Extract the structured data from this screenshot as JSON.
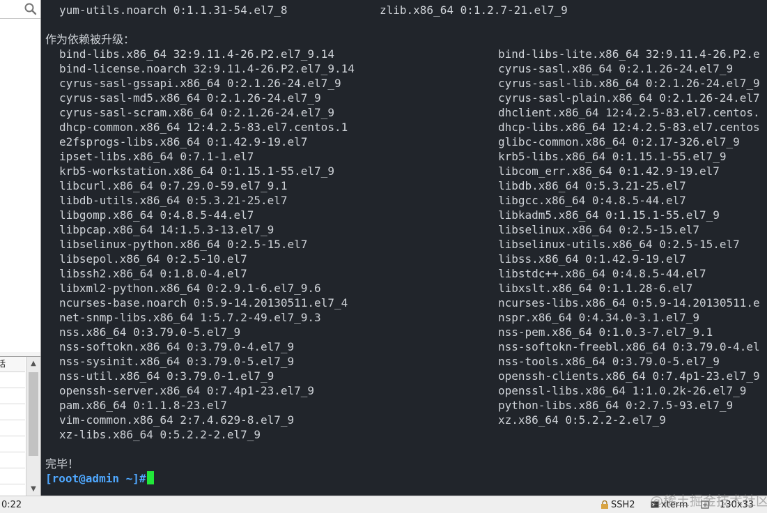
{
  "terminal": {
    "line_top_a": "yum-utils.noarch 0:1.1.31-54.el7_8",
    "line_top_b": "zlib.x86_64 0:1.2.7-21.el7_9",
    "section_header": "作为依赖被升级：",
    "left_col": [
      "bind-libs.x86_64 32:9.11.4-26.P2.el7_9.14",
      "bind-license.noarch 32:9.11.4-26.P2.el7_9.14",
      "cyrus-sasl-gssapi.x86_64 0:2.1.26-24.el7_9",
      "cyrus-sasl-md5.x86_64 0:2.1.26-24.el7_9",
      "cyrus-sasl-scram.x86_64 0:2.1.26-24.el7_9",
      "dhcp-common.x86_64 12:4.2.5-83.el7.centos.1",
      "e2fsprogs-libs.x86_64 0:1.42.9-19.el7",
      "ipset-libs.x86_64 0:7.1-1.el7",
      "krb5-workstation.x86_64 0:1.15.1-55.el7_9",
      "libcurl.x86_64 0:7.29.0-59.el7_9.1",
      "libdb-utils.x86_64 0:5.3.21-25.el7",
      "libgomp.x86_64 0:4.8.5-44.el7",
      "libpcap.x86_64 14:1.5.3-13.el7_9",
      "libselinux-python.x86_64 0:2.5-15.el7",
      "libsepol.x86_64 0:2.5-10.el7",
      "libssh2.x86_64 0:1.8.0-4.el7",
      "libxml2-python.x86_64 0:2.9.1-6.el7_9.6",
      "ncurses-base.noarch 0:5.9-14.20130511.el7_4",
      "net-snmp-libs.x86_64 1:5.7.2-49.el7_9.3",
      "nss.x86_64 0:3.79.0-5.el7_9",
      "nss-softokn.x86_64 0:3.79.0-4.el7_9",
      "nss-sysinit.x86_64 0:3.79.0-5.el7_9",
      "nss-util.x86_64 0:3.79.0-1.el7_9",
      "openssh-server.x86_64 0:7.4p1-23.el7_9",
      "pam.x86_64 0:1.1.8-23.el7",
      "vim-common.x86_64 2:7.4.629-8.el7_9",
      "xz-libs.x86_64 0:5.2.2-2.el7_9"
    ],
    "right_col": [
      "bind-libs-lite.x86_64 32:9.11.4-26.P2.e",
      "cyrus-sasl.x86_64 0:2.1.26-24.el7_9",
      "cyrus-sasl-lib.x86_64 0:2.1.26-24.el7_9",
      "cyrus-sasl-plain.x86_64 0:2.1.26-24.el7",
      "dhclient.x86_64 12:4.2.5-83.el7.centos.",
      "dhcp-libs.x86_64 12:4.2.5-83.el7.centos",
      "glibc-common.x86_64 0:2.17-326.el7_9",
      "krb5-libs.x86_64 0:1.15.1-55.el7_9",
      "libcom_err.x86_64 0:1.42.9-19.el7",
      "libdb.x86_64 0:5.3.21-25.el7",
      "libgcc.x86_64 0:4.8.5-44.el7",
      "libkadm5.x86_64 0:1.15.1-55.el7_9",
      "libselinux.x86_64 0:2.5-15.el7",
      "libselinux-utils.x86_64 0:2.5-15.el7",
      "libss.x86_64 0:1.42.9-19.el7",
      "libstdc++.x86_64 0:4.8.5-44.el7",
      "libxslt.x86_64 0:1.1.28-6.el7",
      "ncurses-libs.x86_64 0:5.9-14.20130511.e",
      "nspr.x86_64 0:4.34.0-3.1.el7_9",
      "nss-pem.x86_64 0:1.0.3-7.el7_9.1",
      "nss-softokn-freebl.x86_64 0:3.79.0-4.el",
      "nss-tools.x86_64 0:3.79.0-5.el7_9",
      "openssh-clients.x86_64 0:7.4p1-23.el7_9",
      "openssl-libs.x86_64 1:1.0.2k-26.el7_9",
      "python-libs.x86_64 0:2.7.5-93.el7_9",
      "xz.x86_64 0:5.2.2-2.el7_9"
    ],
    "done_text": "完毕！",
    "prompt": "[root@admin ~]#"
  },
  "left_panel": {
    "list_header": "话",
    "time": "0:22"
  },
  "status_bar": {
    "protocol": "SSH2",
    "term_type": "xterm",
    "size": "130x33"
  },
  "watermark": "@稀土掘金技术社区",
  "colors": {
    "terminal_bg": "#21252b",
    "terminal_fg": "#cfd3d8",
    "prompt": "#4fa8ff",
    "cursor": "#22e83a"
  },
  "icons": [
    "search-icon",
    "lock-icon",
    "terminal-icon",
    "resize-icon"
  ]
}
